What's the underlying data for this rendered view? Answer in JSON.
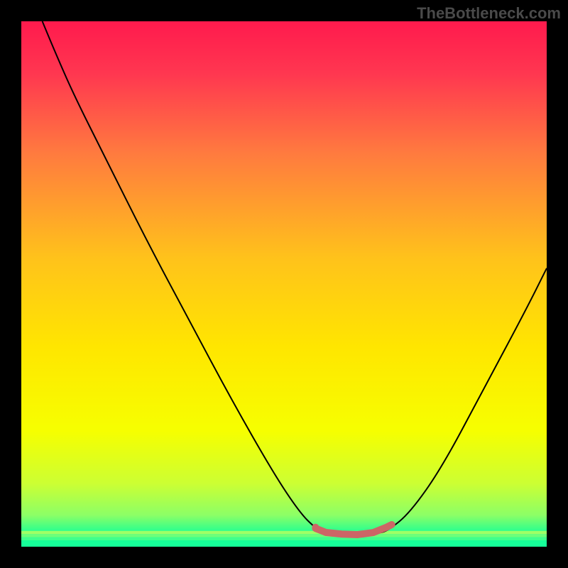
{
  "watermark": "TheBottleneck.com",
  "chart_data": {
    "type": "line",
    "title": "",
    "xlabel": "",
    "ylabel": "",
    "xlim": [
      0,
      100
    ],
    "ylim": [
      0,
      100
    ],
    "grid": false,
    "gradient_stops": [
      {
        "pos": 0.0,
        "color": "#ff1a4d"
      },
      {
        "pos": 0.1,
        "color": "#ff3750"
      },
      {
        "pos": 0.25,
        "color": "#ff7a3f"
      },
      {
        "pos": 0.45,
        "color": "#ffc21b"
      },
      {
        "pos": 0.62,
        "color": "#ffe600"
      },
      {
        "pos": 0.78,
        "color": "#f6ff00"
      },
      {
        "pos": 0.88,
        "color": "#ccff33"
      },
      {
        "pos": 0.94,
        "color": "#8cff66"
      },
      {
        "pos": 0.97,
        "color": "#2dff8e"
      },
      {
        "pos": 1.0,
        "color": "#00ff99"
      }
    ],
    "green_bands": [
      {
        "y": 97.0,
        "height": 0.6,
        "color": "#9fff66"
      },
      {
        "y": 97.6,
        "height": 0.6,
        "color": "#6dff7a"
      },
      {
        "y": 98.2,
        "height": 0.6,
        "color": "#3fff8c"
      },
      {
        "y": 98.8,
        "height": 1.2,
        "color": "#16ff99"
      }
    ],
    "series": [
      {
        "name": "bottleneck-curve",
        "color": "#000000",
        "stroke_width": 2,
        "points": [
          {
            "x": 4.0,
            "y": 0.0
          },
          {
            "x": 6.5,
            "y": 6.0
          },
          {
            "x": 10.0,
            "y": 14.0
          },
          {
            "x": 16.0,
            "y": 26.0
          },
          {
            "x": 24.0,
            "y": 42.0
          },
          {
            "x": 32.0,
            "y": 57.0
          },
          {
            "x": 40.0,
            "y": 72.0
          },
          {
            "x": 48.0,
            "y": 86.0
          },
          {
            "x": 53.0,
            "y": 93.5
          },
          {
            "x": 56.0,
            "y": 96.5
          },
          {
            "x": 58.0,
            "y": 97.5
          },
          {
            "x": 63.0,
            "y": 98.0
          },
          {
            "x": 68.0,
            "y": 97.5
          },
          {
            "x": 70.0,
            "y": 96.8
          },
          {
            "x": 74.0,
            "y": 93.5
          },
          {
            "x": 80.0,
            "y": 85.0
          },
          {
            "x": 88.0,
            "y": 70.0
          },
          {
            "x": 96.0,
            "y": 55.0
          },
          {
            "x": 100.0,
            "y": 47.0
          }
        ]
      },
      {
        "name": "optimal-highlight",
        "color": "#cc6666",
        "stroke_width": 10,
        "stroke_linecap": "round",
        "points": [
          {
            "x": 56.0,
            "y": 96.5
          },
          {
            "x": 58.0,
            "y": 97.3
          },
          {
            "x": 61.0,
            "y": 97.6
          },
          {
            "x": 64.0,
            "y": 97.7
          },
          {
            "x": 67.0,
            "y": 97.3
          },
          {
            "x": 69.5,
            "y": 96.3
          },
          {
            "x": 70.5,
            "y": 95.8
          }
        ]
      }
    ],
    "marker": {
      "x": 56.0,
      "y": 96.3,
      "r": 5,
      "color": "#cc6666"
    }
  }
}
